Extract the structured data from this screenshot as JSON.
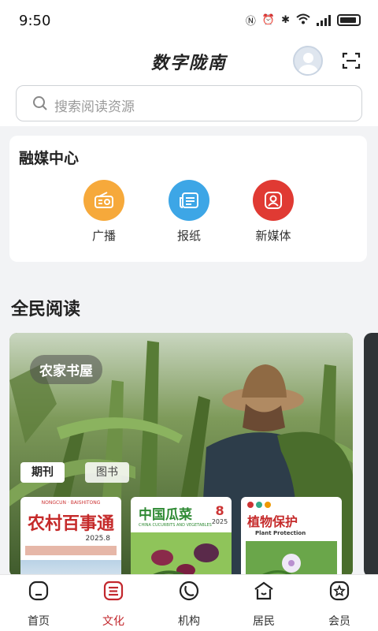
{
  "status_bar": {
    "time": "9:50"
  },
  "header": {
    "app_logo": "数字陇南",
    "search": {
      "placeholder": "搜索阅读资源"
    }
  },
  "media_center": {
    "title": "融媒中心",
    "items": [
      {
        "label": "广播",
        "icon": "radio-icon",
        "color": "#f6a93b"
      },
      {
        "label": "报纸",
        "icon": "newspaper-icon",
        "color": "#3da6e6"
      },
      {
        "label": "新媒体",
        "icon": "new-media-icon",
        "color": "#e03a33"
      }
    ]
  },
  "reading": {
    "title": "全民阅读",
    "banner": {
      "tag": "农家书屋",
      "tabs": [
        "期刊",
        "图书"
      ],
      "magazines": [
        {
          "title": "农村百事通",
          "issue": "2025.8"
        },
        {
          "title": "中国瓜菜",
          "subtitle": "CHINA CUCURBITS AND VEGETABLES",
          "issue": "8",
          "year": "2025"
        },
        {
          "title": "植物保护",
          "subtitle": "Plant Protection"
        }
      ]
    }
  },
  "bottom_nav": {
    "items": [
      {
        "label": "首页",
        "icon": "home-icon"
      },
      {
        "label": "文化",
        "icon": "culture-icon",
        "active": true
      },
      {
        "label": "机构",
        "icon": "institution-icon"
      },
      {
        "label": "居民",
        "icon": "resident-icon"
      },
      {
        "label": "会员",
        "icon": "member-icon"
      }
    ]
  }
}
